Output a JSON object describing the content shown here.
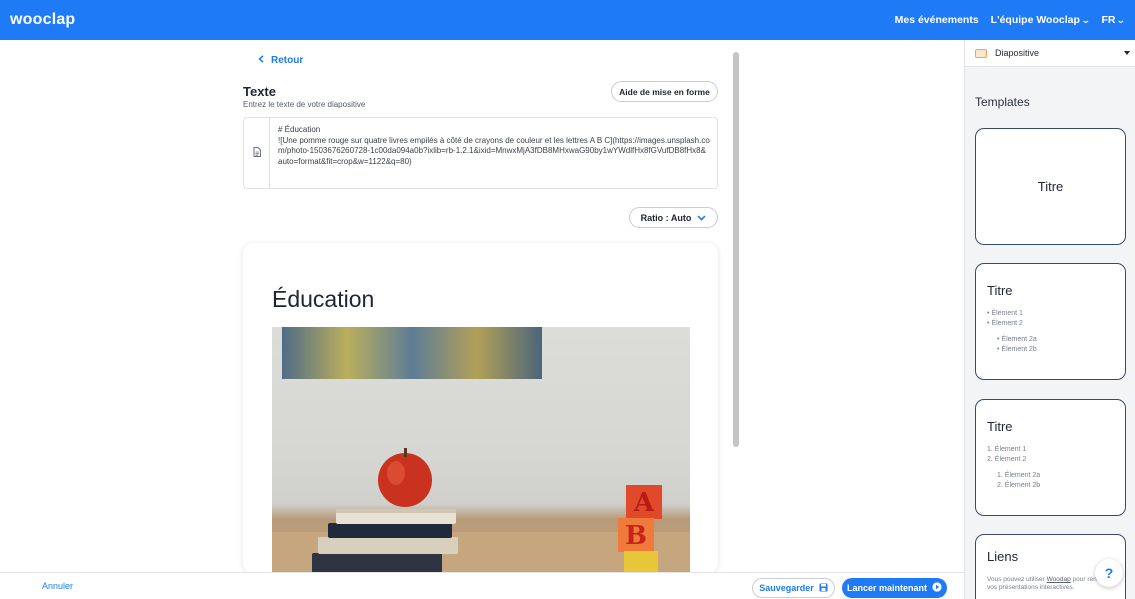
{
  "app": {
    "logo": "wooclap",
    "nav": {
      "events": "Mes événements",
      "team": "L'équipe Wooclap",
      "lang": "FR"
    }
  },
  "editor": {
    "back_label": "Retour",
    "section_title": "Texte",
    "section_subtitle": "Entrez le texte de votre diapositive",
    "help_button": "Aide de mise en forme",
    "markdown_text": "# Éducation\n![Une pomme rouge sur quatre livres empilés à côté de crayons de couleur et les lettres A B C](https://images.unsplash.com/photo-1503676260728-1c00da094a0b?ixlib=rb-1.2.1&ixid=MnwxMjA3fDB8MHxwaG90by1wYWdlfHx8fGVufDB8fHx8&auto=format&fit=crop&w=1122&q=80)",
    "ratio_label": "Ratio : Auto"
  },
  "slide": {
    "title": "Éducation",
    "image_alt": "Une pomme rouge sur quatre livres empilés à côté de crayons de couleur et les lettres A B C",
    "blocks": [
      "A",
      "B"
    ]
  },
  "footer": {
    "cancel": "Annuler",
    "save": "Sauvegarder",
    "launch": "Lancer maintenant"
  },
  "sidebar": {
    "type_select": "Diapositive",
    "templates_title": "Templates",
    "templates": [
      {
        "title": "Titre"
      },
      {
        "title": "Titre",
        "items": [
          "Élement 1",
          "Élement 2"
        ],
        "subitems": [
          "Élement 2a",
          "Élement 2b"
        ]
      },
      {
        "title": "Titre",
        "items": [
          "1. Élement 1",
          "2. Élement 2"
        ],
        "subitems": [
          "1. Élement 2a",
          "2. Élement 2b"
        ]
      },
      {
        "title": "Liens",
        "desc_prefix": "Vous pouvez utiliser ",
        "desc_link": "Woodap",
        "desc_suffix": " pour rendre vos présentations interactives."
      }
    ]
  },
  "help_bubble": "?",
  "colors": {
    "primary": "#1f7bf5",
    "template_border": "#3a4a6b",
    "sidebar_bg": "#f3f4f6"
  }
}
